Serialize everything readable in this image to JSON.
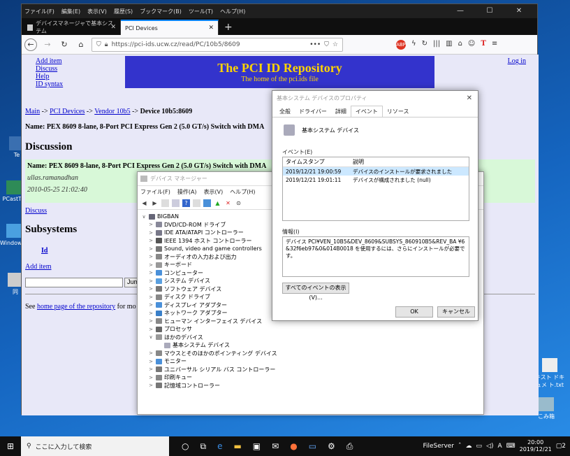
{
  "colors": {
    "banner_bg": "#3333cc",
    "banner_text": "#ffd400",
    "page_bg": "#e8e8f8",
    "discussion_bg": "#d8f8d8",
    "selected_row": "#cce8ff"
  },
  "desktop": {
    "icons": [
      "Te",
      "PCastTV",
      "Window ラーモ",
      "同",
      "こみ箱"
    ],
    "right_label": "キスト ドキュメ ト.txt"
  },
  "firefox": {
    "menu": [
      "ファイル(F)",
      "編集(E)",
      "表示(V)",
      "履歴(S)",
      "ブックマーク(B)",
      "ツール(T)",
      "ヘルプ(H)"
    ],
    "tabs": [
      {
        "label": "デバイスマネージャで基本システム"
      },
      {
        "label": "PCI Devices"
      }
    ],
    "url": "https://pci-ids.ucw.cz/read/PC/10b5/8609",
    "url_more": "•••"
  },
  "page": {
    "side_links": [
      "Add item",
      "Discuss",
      "Help",
      "ID syntax"
    ],
    "banner_title": "The PCI ID Repository",
    "banner_sub": "The home of the pci.ids file",
    "login": "Log in",
    "crumb": {
      "main": "Main",
      "pci": "PCI Devices",
      "vendor": "Vendor 10b5",
      "device": "Device 10b5:8609",
      "arrow": "->"
    },
    "name": "Name: PEX 8609 8-lane, 8-Port PCI Express Gen 2 (5.0 GT/s) Switch with DMA",
    "h_discussion": "Discussion",
    "disc_name": "Name: PEX 8609 8-lane, 8-Port PCI Express Gen 2 (5.0 GT/s) Switch with DMA",
    "disc_user": "ullas.ramanadhan",
    "disc_time": "2010-05-25 21:02:40",
    "discuss_link": "Discuss",
    "h_subsystems": "Subsystems",
    "id_col": "Id",
    "add_item": "Add item",
    "jump_btn": "Jum",
    "footer_pre": "See",
    "footer_link": "home page of the repository",
    "footer_post": "for mo"
  },
  "devmgr": {
    "title": "デバイス マネージャー",
    "menu": [
      "ファイル(F)",
      "操作(A)",
      "表示(V)",
      "ヘルプ(H)"
    ],
    "tree": [
      {
        "label": "BIGBAN",
        "level": 0,
        "exp": "∨",
        "color": "#667"
      },
      {
        "label": "DVD/CD-ROM ドライブ",
        "level": 1,
        "exp": ">",
        "color": "#889"
      },
      {
        "label": "IDE ATA/ATAPI コントローラー",
        "level": 1,
        "exp": ">",
        "color": "#778"
      },
      {
        "label": "IEEE 1394 ホスト コントローラー",
        "level": 1,
        "exp": ">",
        "color": "#555"
      },
      {
        "label": "Sound, video and game controllers",
        "level": 1,
        "exp": ">",
        "color": "#777"
      },
      {
        "label": "オーディオの入力および出力",
        "level": 1,
        "exp": ">",
        "color": "#888"
      },
      {
        "label": "キーボード",
        "level": 1,
        "exp": ">",
        "color": "#999"
      },
      {
        "label": "コンピューター",
        "level": 1,
        "exp": ">",
        "color": "#4a90d9"
      },
      {
        "label": "システム デバイス",
        "level": 1,
        "exp": ">",
        "color": "#5aa0e0"
      },
      {
        "label": "ソフトウェア デバイス",
        "level": 1,
        "exp": ">",
        "color": "#777"
      },
      {
        "label": "ディスク ドライブ",
        "level": 1,
        "exp": ">",
        "color": "#888"
      },
      {
        "label": "ディスプレイ アダプター",
        "level": 1,
        "exp": ">",
        "color": "#4a90d9"
      },
      {
        "label": "ネットワーク アダプター",
        "level": 1,
        "exp": ">",
        "color": "#3a80c9"
      },
      {
        "label": "ヒューマン インターフェイス デバイス",
        "level": 1,
        "exp": ">",
        "color": "#888"
      },
      {
        "label": "プロセッサ",
        "level": 1,
        "exp": ">",
        "color": "#666"
      },
      {
        "label": "ほかのデバイス",
        "level": 1,
        "exp": "∨",
        "color": "#999"
      },
      {
        "label": "基本システム デバイス",
        "level": 2,
        "exp": "",
        "color": "#aab"
      },
      {
        "label": "マウスとそのほかのポインティング デバイス",
        "level": 1,
        "exp": ">",
        "color": "#888"
      },
      {
        "label": "モニター",
        "level": 1,
        "exp": ">",
        "color": "#4a90d9"
      },
      {
        "label": "ユニバーサル シリアル バス コントローラー",
        "level": 1,
        "exp": ">",
        "color": "#777"
      },
      {
        "label": "印刷キュー",
        "level": 1,
        "exp": ">",
        "color": "#888"
      },
      {
        "label": "記憶域コントローラー",
        "level": 1,
        "exp": ">",
        "color": "#777"
      }
    ]
  },
  "props": {
    "title": "基本システム デバイスのプロパティ",
    "tabs": [
      "全般",
      "ドライバー",
      "詳細",
      "イベント",
      "リソース"
    ],
    "device_name": "基本システム デバイス",
    "events_label": "イベント(E)",
    "col_time": "タイムスタンプ",
    "col_desc": "説明",
    "events": [
      {
        "time": "2019/12/21 19:00:59",
        "desc": "デバイスのインストールが要求されました"
      },
      {
        "time": "2019/12/21 19:01:11",
        "desc": "デバイスが構成されました (null)"
      }
    ],
    "info_label": "情報(I)",
    "info_text": "デバイス PCI¥VEN_10B5&DEV_8609&SUBSYS_860910B5&REV_BA ¥6&32f6eb97&0&014B0018 を使用するには、さらにインストールが必要です。",
    "all_events_btn": "すべてのイベントの表示(V)...",
    "ok": "OK",
    "cancel": "キャンセル"
  },
  "taskbar": {
    "search_placeholder": "ここに入力して検索",
    "app_label": "FileServer",
    "ime": "A",
    "time": "20:00",
    "date": "2019/12/21",
    "notif": "2"
  }
}
